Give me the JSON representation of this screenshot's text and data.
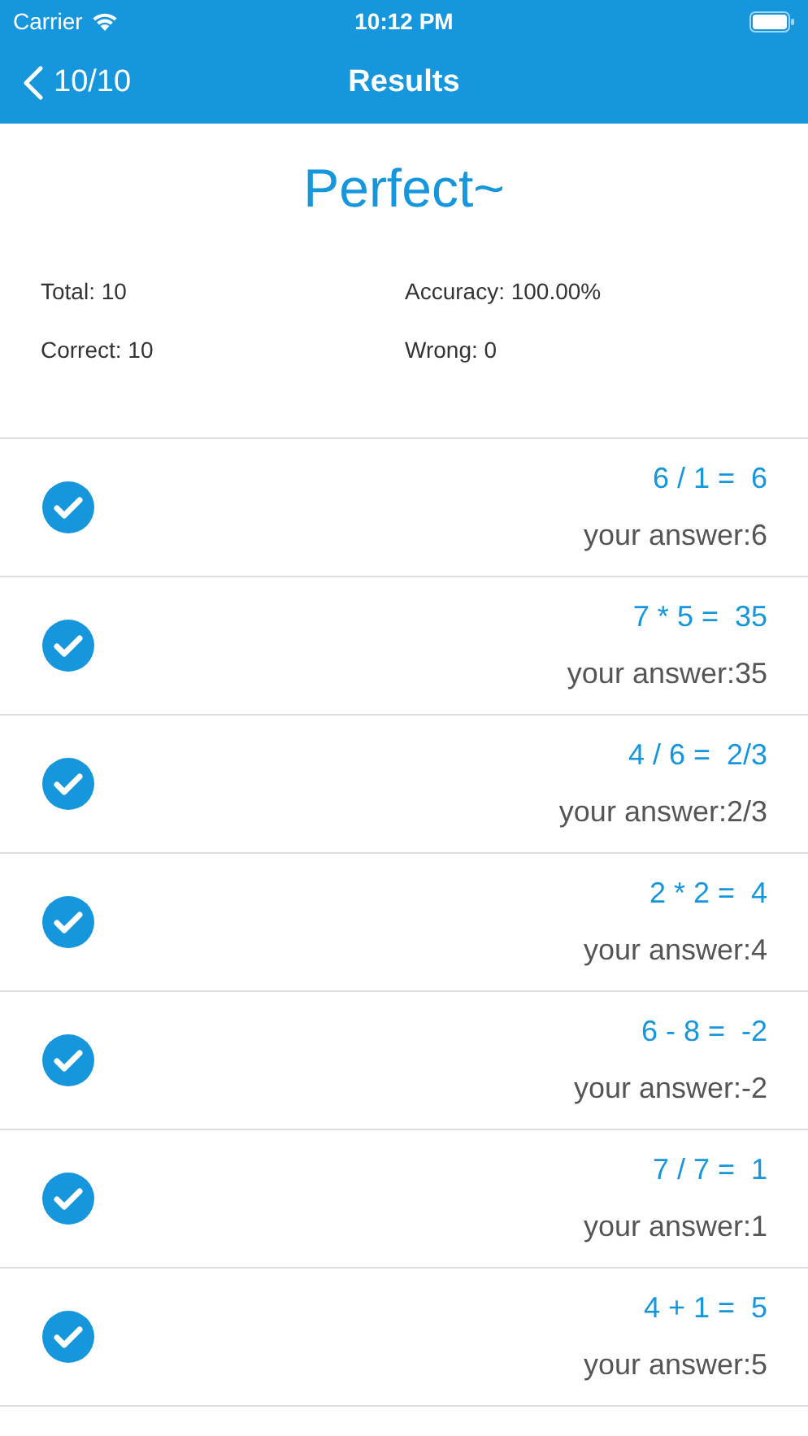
{
  "status_bar": {
    "carrier": "Carrier",
    "time": "10:12 PM"
  },
  "nav": {
    "back_label": "10/10",
    "title": "Results"
  },
  "heading": "Perfect~",
  "stats": [
    {
      "label": "Total: 10"
    },
    {
      "label": "Accuracy: 100.00%"
    },
    {
      "label": "Correct: 10"
    },
    {
      "label": "Wrong: 0"
    }
  ],
  "results": [
    {
      "equation": "6 / 1 =  6",
      "answer": "your answer:6",
      "correct": true
    },
    {
      "equation": "7 * 5 =  35",
      "answer": "your answer:35",
      "correct": true
    },
    {
      "equation": "4 / 6 =  2/3",
      "answer": "your answer:2/3",
      "correct": true
    },
    {
      "equation": "2 * 2 =  4",
      "answer": "your answer:4",
      "correct": true
    },
    {
      "equation": "6 - 8 =  -2",
      "answer": "your answer:-2",
      "correct": true
    },
    {
      "equation": "7 / 7 =  1",
      "answer": "your answer:1",
      "correct": true
    },
    {
      "equation": "4 + 1 =  5",
      "answer": "your answer:5",
      "correct": true
    }
  ]
}
